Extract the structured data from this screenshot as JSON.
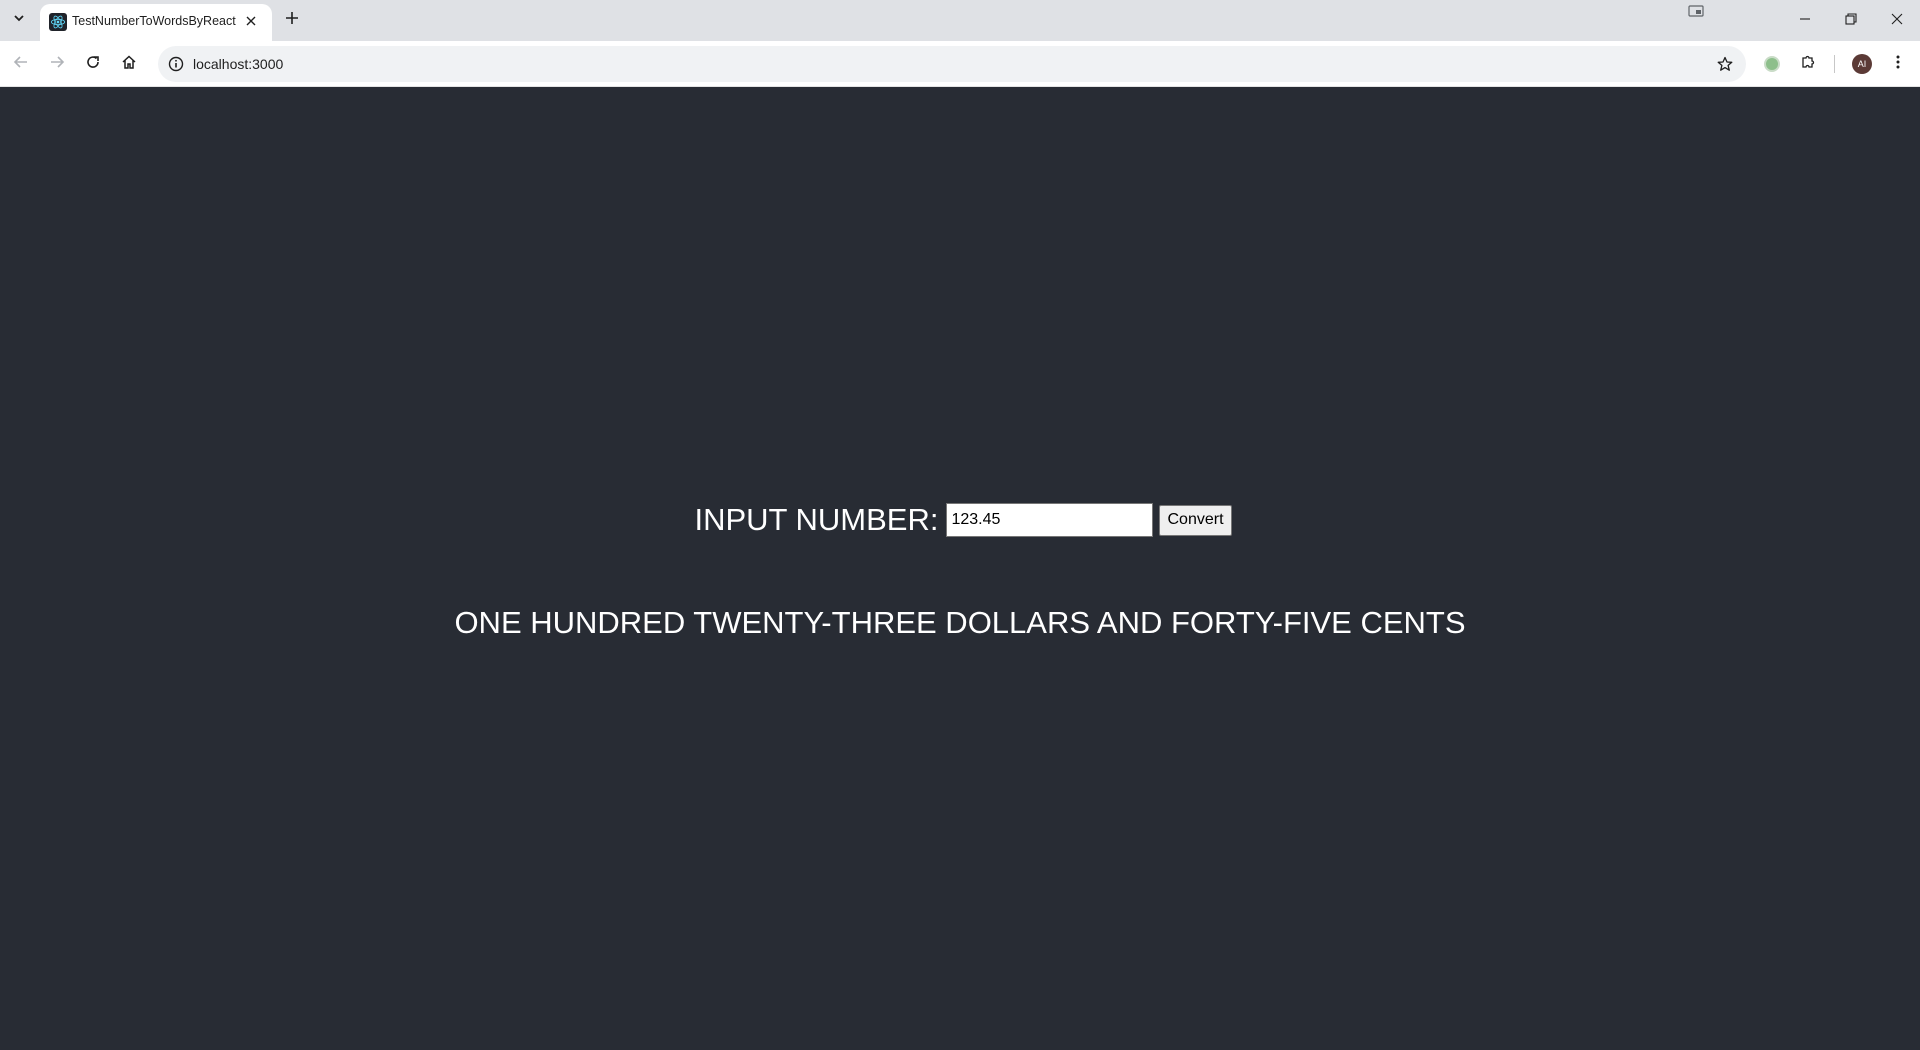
{
  "browser": {
    "tab": {
      "title": "TestNumberToWordsByReact"
    },
    "address_bar": {
      "url": "localhost:3000"
    },
    "profile_initials": "AI"
  },
  "page": {
    "label": "INPUT NUMBER:",
    "input_value": "123.45",
    "button_label": "Convert",
    "result_text": "ONE HUNDRED TWENTY-THREE DOLLARS AND FORTY-FIVE CENTS"
  },
  "colors": {
    "page_background": "#282c34",
    "text": "#ffffff",
    "tabstrip": "#dfe1e5"
  },
  "icons": {
    "tab_search": "chevron-down-icon",
    "favicon": "react-icon",
    "tab_close": "close-icon",
    "new_tab": "plus-icon",
    "back": "arrow-left-icon",
    "forward": "arrow-right-icon",
    "reload": "reload-icon",
    "home": "home-icon",
    "site_info": "info-icon",
    "bookmark": "star-icon",
    "extensions": "puzzle-icon",
    "menu": "kebab-menu-icon"
  }
}
